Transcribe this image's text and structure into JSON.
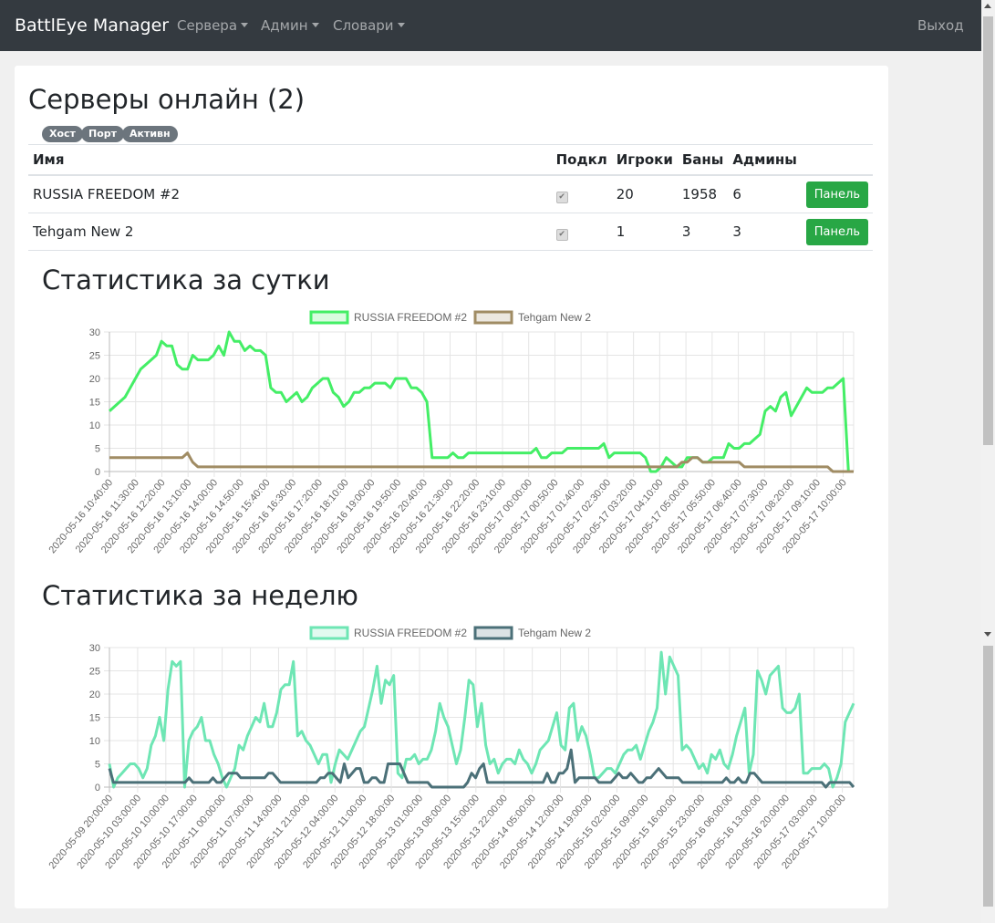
{
  "nav": {
    "brand": "BattlEye Manager",
    "items": [
      "Сервера",
      "Админ",
      "Словари"
    ],
    "logout": "Выход"
  },
  "page": {
    "title": "Серверы онлайн (2)",
    "badges": [
      "Хост",
      "Порт",
      "Активн"
    ]
  },
  "table": {
    "headers": [
      "Имя",
      "Подкл",
      "Игроки",
      "Баны",
      "Админы"
    ],
    "rows": [
      {
        "name": "RUSSIA FREEDOM #2",
        "connected": true,
        "players": "20",
        "bans": "1958",
        "admins": "6",
        "button": "Панель"
      },
      {
        "name": "Tehgam New 2",
        "connected": true,
        "players": "1",
        "bans": "3",
        "admins": "3",
        "button": "Панель"
      }
    ]
  },
  "sections": {
    "day": "Статистика за сутки",
    "week": "Статистика за неделю"
  },
  "colors": {
    "green": "#28a745",
    "navbar": "#343a40",
    "day_s1": "#44ee66",
    "day_s2": "#a08c64",
    "week_s1": "#6ee6b4",
    "week_s2": "#4b7078"
  },
  "chart_data": [
    {
      "type": "line",
      "title": "",
      "ylim": [
        0,
        30
      ],
      "yticks": [
        0,
        5,
        10,
        15,
        20,
        25,
        30
      ],
      "xticks": [
        "2020-05-16 10:40:00",
        "2020-05-16 11:30:00",
        "2020-05-16 12:20:00",
        "2020-05-16 13:10:00",
        "2020-05-16 14:00:00",
        "2020-05-16 14:50:00",
        "2020-05-16 15:40:00",
        "2020-05-16 16:30:00",
        "2020-05-16 17:20:00",
        "2020-05-16 18:10:00",
        "2020-05-16 19:00:00",
        "2020-05-16 19:50:00",
        "2020-05-16 20:40:00",
        "2020-05-16 21:30:00",
        "2020-05-16 22:20:00",
        "2020-05-16 23:10:00",
        "2020-05-17 00:00:00",
        "2020-05-17 00:50:00",
        "2020-05-17 01:40:00",
        "2020-05-17 02:30:00",
        "2020-05-17 03:20:00",
        "2020-05-17 04:10:00",
        "2020-05-17 05:00:00",
        "2020-05-17 05:50:00",
        "2020-05-17 06:40:00",
        "2020-05-17 07:30:00",
        "2020-05-17 08:20:00",
        "2020-05-17 09:10:00",
        "2020-05-17 10:00:00"
      ],
      "series": [
        {
          "name": "RUSSIA FREEDOM #2",
          "values": [
            13,
            14,
            15,
            16,
            18,
            20,
            22,
            23,
            24,
            25,
            28,
            27,
            27,
            23,
            22,
            22,
            25,
            24,
            24,
            24,
            25,
            27,
            25,
            30,
            28,
            28,
            26,
            27,
            26,
            26,
            25,
            18,
            17,
            17,
            15,
            16,
            17,
            15,
            16,
            18,
            19,
            20,
            20,
            17,
            16,
            14,
            15,
            17,
            17,
            18,
            18,
            19,
            19,
            19,
            18,
            20,
            20,
            20,
            18,
            18,
            17,
            15,
            3,
            3,
            3,
            3,
            4,
            3,
            3,
            4,
            4,
            4,
            4,
            4,
            4,
            4,
            4,
            4,
            4,
            4,
            4,
            4,
            5,
            3,
            3,
            4,
            4,
            4,
            5,
            5,
            5,
            5,
            5,
            5,
            5,
            6,
            3,
            4,
            4,
            4,
            4,
            4,
            4,
            3,
            0,
            0,
            1,
            3,
            2,
            1,
            1,
            3,
            3,
            3,
            2,
            2,
            3,
            3,
            3,
            6,
            5,
            5,
            6,
            6,
            7,
            8,
            13,
            14,
            13,
            16,
            17,
            12,
            14,
            16,
            18,
            17,
            17,
            17,
            18,
            18,
            19,
            20,
            0,
            0
          ],
          "color": "#44ee66"
        },
        {
          "name": "Tehgam New 2",
          "values": [
            3,
            3,
            3,
            3,
            3,
            3,
            3,
            3,
            3,
            3,
            3,
            3,
            3,
            3,
            3,
            4,
            2,
            1,
            1,
            1,
            1,
            1,
            1,
            1,
            1,
            1,
            1,
            1,
            1,
            1,
            1,
            1,
            1,
            1,
            1,
            1,
            1,
            1,
            1,
            1,
            1,
            1,
            1,
            1,
            1,
            1,
            1,
            1,
            1,
            1,
            1,
            1,
            1,
            1,
            1,
            1,
            1,
            1,
            1,
            1,
            1,
            1,
            1,
            1,
            1,
            1,
            1,
            1,
            1,
            1,
            1,
            1,
            1,
            1,
            1,
            1,
            1,
            1,
            1,
            1,
            1,
            1,
            1,
            1,
            1,
            1,
            1,
            1,
            1,
            1,
            1,
            1,
            1,
            1,
            1,
            1,
            1,
            1,
            1,
            1,
            1,
            1,
            1,
            1,
            1,
            1,
            1,
            1,
            1,
            1,
            2,
            2,
            3,
            3,
            2,
            2,
            2,
            2,
            2,
            2,
            2,
            2,
            1,
            1,
            1,
            1,
            1,
            1,
            1,
            1,
            1,
            1,
            1,
            1,
            1,
            1,
            1,
            1,
            1,
            0,
            0,
            0,
            0,
            0
          ],
          "color": "#a08c64"
        }
      ]
    },
    {
      "type": "line",
      "title": "",
      "ylim": [
        0,
        30
      ],
      "yticks": [
        0,
        5,
        10,
        15,
        20,
        25,
        30
      ],
      "xticks": [
        "2020-05-09 20:00:00",
        "2020-05-10 03:00:00",
        "2020-05-10 10:00:00",
        "2020-05-10 17:00:00",
        "2020-05-11 00:00:00",
        "2020-05-11 07:00:00",
        "2020-05-11 14:00:00",
        "2020-05-11 21:00:00",
        "2020-05-12 04:00:00",
        "2020-05-12 11:00:00",
        "2020-05-12 18:00:00",
        "2020-05-13 01:00:00",
        "2020-05-13 08:00:00",
        "2020-05-13 15:00:00",
        "2020-05-13 22:00:00",
        "2020-05-14 05:00:00",
        "2020-05-14 12:00:00",
        "2020-05-14 19:00:00",
        "2020-05-15 02:00:00",
        "2020-05-15 09:00:00",
        "2020-05-15 16:00:00",
        "2020-05-15 23:00:00",
        "2020-05-16 06:00:00",
        "2020-05-16 13:00:00",
        "2020-05-16 20:00:00",
        "2020-05-17 03:00:00",
        "2020-05-17 10:00:00"
      ],
      "series": [
        {
          "name": "RUSSIA FREEDOM #2",
          "values": [
            5,
            0,
            2,
            3,
            4,
            5,
            5,
            4,
            2,
            4,
            9,
            11,
            15,
            10,
            21,
            27,
            26,
            27,
            0,
            10,
            12,
            13,
            15,
            10,
            10,
            7,
            5,
            2,
            0,
            2,
            4,
            9,
            8,
            11,
            13,
            15,
            14,
            18,
            13,
            13,
            16,
            21,
            22,
            22,
            27,
            11,
            12,
            10,
            9,
            7,
            5,
            7,
            7,
            1,
            5,
            8,
            7,
            6,
            8,
            10,
            12,
            13,
            17,
            21,
            26,
            18,
            23,
            22,
            24,
            3,
            2,
            6,
            6,
            7,
            5,
            6,
            6,
            8,
            12,
            18,
            15,
            13,
            9,
            5,
            8,
            15,
            23,
            22,
            13,
            18,
            9,
            5,
            6,
            3,
            5,
            6,
            6,
            5,
            8,
            6,
            5,
            3,
            5,
            8,
            9,
            10,
            13,
            16,
            9,
            8,
            17,
            18,
            10,
            13,
            11,
            7,
            2,
            2,
            3,
            4,
            4,
            3,
            5,
            7,
            8,
            8,
            9,
            6,
            9,
            12,
            14,
            17,
            29,
            20,
            28,
            26,
            24,
            8,
            9,
            8,
            6,
            4,
            5,
            3,
            7,
            6,
            8,
            5,
            4,
            7,
            11,
            14,
            17,
            3,
            7,
            25,
            23,
            20,
            24,
            25,
            26,
            17,
            16,
            16,
            17,
            20,
            3,
            3,
            4,
            4,
            4,
            5,
            4,
            0,
            2,
            5,
            14,
            16,
            18
          ],
          "color": "#6ee6b4"
        },
        {
          "name": "Tehgam New 2",
          "values": [
            4,
            1,
            1,
            1,
            1,
            1,
            1,
            1,
            1,
            1,
            1,
            1,
            1,
            1,
            1,
            1,
            1,
            1,
            1,
            1,
            2,
            1,
            1,
            1,
            1,
            1,
            2,
            1,
            1,
            2,
            3,
            3,
            3,
            2,
            2,
            2,
            2,
            2,
            2,
            2,
            3,
            3,
            2,
            1,
            1,
            1,
            1,
            1,
            1,
            1,
            1,
            1,
            1,
            2,
            2,
            3,
            3,
            2,
            1,
            5,
            2,
            3,
            4,
            4,
            1,
            1,
            2,
            2,
            1,
            1,
            5,
            5,
            5,
            5,
            3,
            1,
            1,
            1,
            1,
            1,
            1,
            0,
            0,
            0,
            0,
            0,
            0,
            0,
            0,
            0,
            1,
            3,
            2,
            4,
            5,
            1,
            1,
            1,
            1,
            1,
            1,
            1,
            1,
            1,
            1,
            1,
            1,
            1,
            1,
            1,
            3,
            1,
            1,
            3,
            3,
            4,
            8,
            1,
            2,
            2,
            2,
            2,
            2,
            1,
            1,
            1,
            1,
            2,
            3,
            2,
            2,
            3,
            2,
            1,
            1,
            2,
            2,
            3,
            4,
            3,
            2,
            2,
            2,
            2,
            1,
            1,
            1,
            1,
            1,
            1,
            1,
            1,
            1,
            1,
            1,
            2,
            1,
            1,
            2,
            1,
            1,
            3,
            3,
            2,
            1,
            1,
            1,
            1,
            1,
            1,
            1,
            1,
            1,
            1,
            1,
            1,
            1,
            1,
            1,
            1,
            0,
            1,
            1,
            1,
            1,
            1,
            1,
            0
          ],
          "color": "#4b7078"
        }
      ]
    }
  ]
}
